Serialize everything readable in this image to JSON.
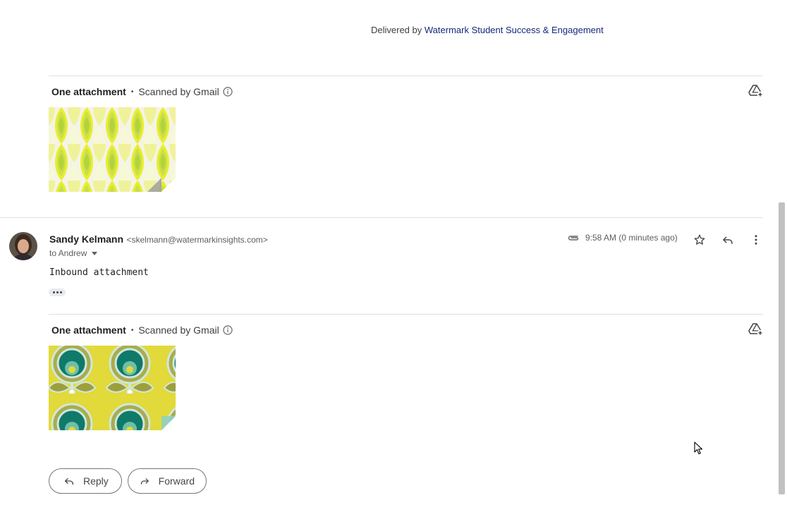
{
  "delivered": {
    "prefix": "Delivered by ",
    "link": "Watermark Student Success & Engagement"
  },
  "attachments_top": {
    "count": "One attachment",
    "dot": "•",
    "scanned": "Scanned by Gmail"
  },
  "message": {
    "sender_name": "Sandy Kelmann",
    "sender_email": "<skelmann@watermarkinsights.com>",
    "recipient": "to Andrew",
    "time": "9:58 AM (0 minutes ago)",
    "body": "Inbound attachment"
  },
  "attachments_bottom": {
    "count": "One attachment",
    "dot": "•",
    "scanned": "Scanned by Gmail"
  },
  "actions": {
    "reply": "Reply",
    "forward": "Forward"
  },
  "icons": [
    "info-icon",
    "add-to-drive-icon",
    "paperclip-icon",
    "star-icon",
    "reply-icon",
    "more-vert-icon",
    "forward-icon",
    "mouse-cursor-icon"
  ],
  "colors": {
    "link": "#15287a",
    "accent_yellow": "#e8ef2a",
    "teal": "#0f7a6a"
  }
}
